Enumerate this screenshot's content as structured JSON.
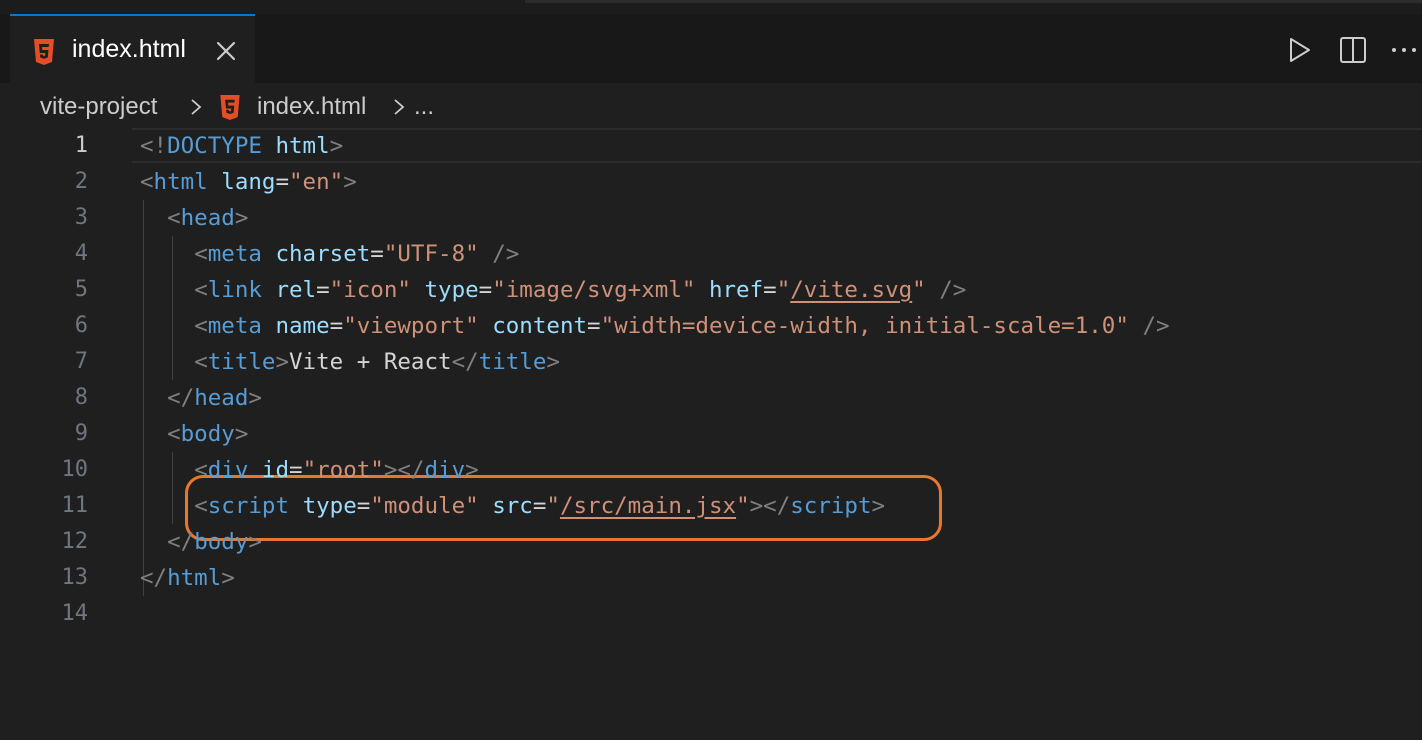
{
  "tab": {
    "label": "index.html",
    "icon": "html5-icon",
    "close_icon": "close-icon"
  },
  "toolbar": {
    "run_icon": "run-icon",
    "split_icon": "split-editor-icon",
    "more_icon": "more-actions-icon"
  },
  "breadcrumb": {
    "items": [
      "vite-project",
      "index.html",
      "..."
    ]
  },
  "editor": {
    "active_line": 1,
    "line_numbers": [
      "1",
      "2",
      "3",
      "4",
      "5",
      "6",
      "7",
      "8",
      "9",
      "10",
      "11",
      "12",
      "13",
      "14"
    ],
    "lines": [
      [
        [
          "punct",
          "<!"
        ],
        [
          "tag",
          "DOCTYPE"
        ],
        [
          "text",
          " "
        ],
        [
          "attr",
          "html"
        ],
        [
          "punct",
          ">"
        ]
      ],
      [
        [
          "punct",
          "<"
        ],
        [
          "tag",
          "html"
        ],
        [
          "text",
          " "
        ],
        [
          "attr",
          "lang"
        ],
        [
          "eq",
          "="
        ],
        [
          "str",
          "\"en\""
        ],
        [
          "punct",
          ">"
        ]
      ],
      [
        [
          "text",
          "  "
        ],
        [
          "punct",
          "<"
        ],
        [
          "tag",
          "head"
        ],
        [
          "punct",
          ">"
        ]
      ],
      [
        [
          "text",
          "    "
        ],
        [
          "punct",
          "<"
        ],
        [
          "tag",
          "meta"
        ],
        [
          "text",
          " "
        ],
        [
          "attr",
          "charset"
        ],
        [
          "eq",
          "="
        ],
        [
          "str",
          "\"UTF-8\""
        ],
        [
          "text",
          " "
        ],
        [
          "punct",
          "/>"
        ]
      ],
      [
        [
          "text",
          "    "
        ],
        [
          "punct",
          "<"
        ],
        [
          "tag",
          "link"
        ],
        [
          "text",
          " "
        ],
        [
          "attr",
          "rel"
        ],
        [
          "eq",
          "="
        ],
        [
          "str",
          "\"icon\""
        ],
        [
          "text",
          " "
        ],
        [
          "attr",
          "type"
        ],
        [
          "eq",
          "="
        ],
        [
          "str",
          "\"image/svg+xml\""
        ],
        [
          "text",
          " "
        ],
        [
          "attr",
          "href"
        ],
        [
          "eq",
          "="
        ],
        [
          "str",
          "\""
        ],
        [
          "strlink",
          "/vite.svg"
        ],
        [
          "str",
          "\""
        ],
        [
          "text",
          " "
        ],
        [
          "punct",
          "/>"
        ]
      ],
      [
        [
          "text",
          "    "
        ],
        [
          "punct",
          "<"
        ],
        [
          "tag",
          "meta"
        ],
        [
          "text",
          " "
        ],
        [
          "attr",
          "name"
        ],
        [
          "eq",
          "="
        ],
        [
          "str",
          "\"viewport\""
        ],
        [
          "text",
          " "
        ],
        [
          "attr",
          "content"
        ],
        [
          "eq",
          "="
        ],
        [
          "str",
          "\"width=device-width, initial-scale=1.0\""
        ],
        [
          "text",
          " "
        ],
        [
          "punct",
          "/>"
        ]
      ],
      [
        [
          "text",
          "    "
        ],
        [
          "punct",
          "<"
        ],
        [
          "tag",
          "title"
        ],
        [
          "punct",
          ">"
        ],
        [
          "text",
          "Vite + React"
        ],
        [
          "punct",
          "</"
        ],
        [
          "tag",
          "title"
        ],
        [
          "punct",
          ">"
        ]
      ],
      [
        [
          "text",
          "  "
        ],
        [
          "punct",
          "</"
        ],
        [
          "tag",
          "head"
        ],
        [
          "punct",
          ">"
        ]
      ],
      [
        [
          "text",
          "  "
        ],
        [
          "punct",
          "<"
        ],
        [
          "tag",
          "body"
        ],
        [
          "punct",
          ">"
        ]
      ],
      [
        [
          "text",
          "    "
        ],
        [
          "punct",
          "<"
        ],
        [
          "tag",
          "div"
        ],
        [
          "text",
          " "
        ],
        [
          "attr",
          "id"
        ],
        [
          "eq",
          "="
        ],
        [
          "str",
          "\"root\""
        ],
        [
          "punct",
          "></"
        ],
        [
          "tag",
          "div"
        ],
        [
          "punct",
          ">"
        ]
      ],
      [
        [
          "text",
          "    "
        ],
        [
          "punct",
          "<"
        ],
        [
          "tag",
          "script"
        ],
        [
          "text",
          " "
        ],
        [
          "attr",
          "type"
        ],
        [
          "eq",
          "="
        ],
        [
          "str",
          "\"module\""
        ],
        [
          "text",
          " "
        ],
        [
          "attr",
          "src"
        ],
        [
          "eq",
          "="
        ],
        [
          "str",
          "\""
        ],
        [
          "strlink",
          "/src/main.jsx"
        ],
        [
          "str",
          "\""
        ],
        [
          "punct",
          "></"
        ],
        [
          "tag",
          "script"
        ],
        [
          "punct",
          ">"
        ]
      ],
      [
        [
          "text",
          "  "
        ],
        [
          "punct",
          "</"
        ],
        [
          "tag",
          "body"
        ],
        [
          "punct",
          ">"
        ]
      ],
      [
        [
          "punct",
          "</"
        ],
        [
          "tag",
          "html"
        ],
        [
          "punct",
          ">"
        ]
      ],
      []
    ]
  },
  "colors": {
    "accent": "#0078d4",
    "callout": "#e8772e",
    "html_icon": "#e44d26"
  }
}
